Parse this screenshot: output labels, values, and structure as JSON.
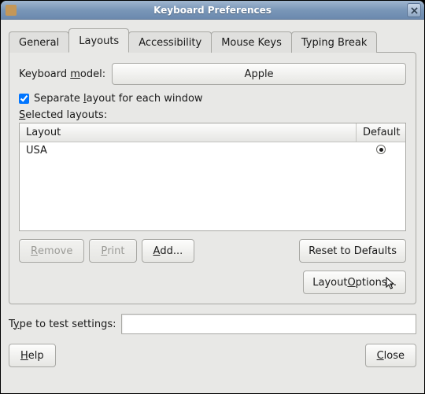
{
  "window": {
    "title": "Keyboard Preferences"
  },
  "tabs": {
    "general": "General",
    "layouts": "Layouts",
    "accessibility": "Accessibility",
    "mouse_keys": "Mouse Keys",
    "typing_break": "Typing Break"
  },
  "layouts_panel": {
    "keyboard_model_label_pre": "Keyboard ",
    "keyboard_model_label_key": "m",
    "keyboard_model_label_post": "odel:",
    "keyboard_model_value": "Apple",
    "separate_layout_pre": "Separate ",
    "separate_layout_key": "l",
    "separate_layout_post": "ayout for each window",
    "separate_layout_checked": true,
    "selected_layouts_label_key": "S",
    "selected_layouts_label_post": "elected layouts:",
    "table": {
      "col_layout": "Layout",
      "col_default": "Default",
      "rows": [
        {
          "layout": "USA",
          "default": true
        }
      ]
    },
    "buttons": {
      "remove_key": "R",
      "remove_post": "emove",
      "print_key": "P",
      "print_post": "rint",
      "add_key": "A",
      "add_post": "dd...",
      "reset": "Reset to Defaults",
      "layout_options_pre": "Layout ",
      "layout_options_key": "O",
      "layout_options_post": "ptions..."
    }
  },
  "footer": {
    "test_label_pre": "T",
    "test_label_key": "y",
    "test_label_post": "pe to test settings:",
    "help_key": "H",
    "help_post": "elp",
    "close_key": "C",
    "close_post": "lose"
  }
}
